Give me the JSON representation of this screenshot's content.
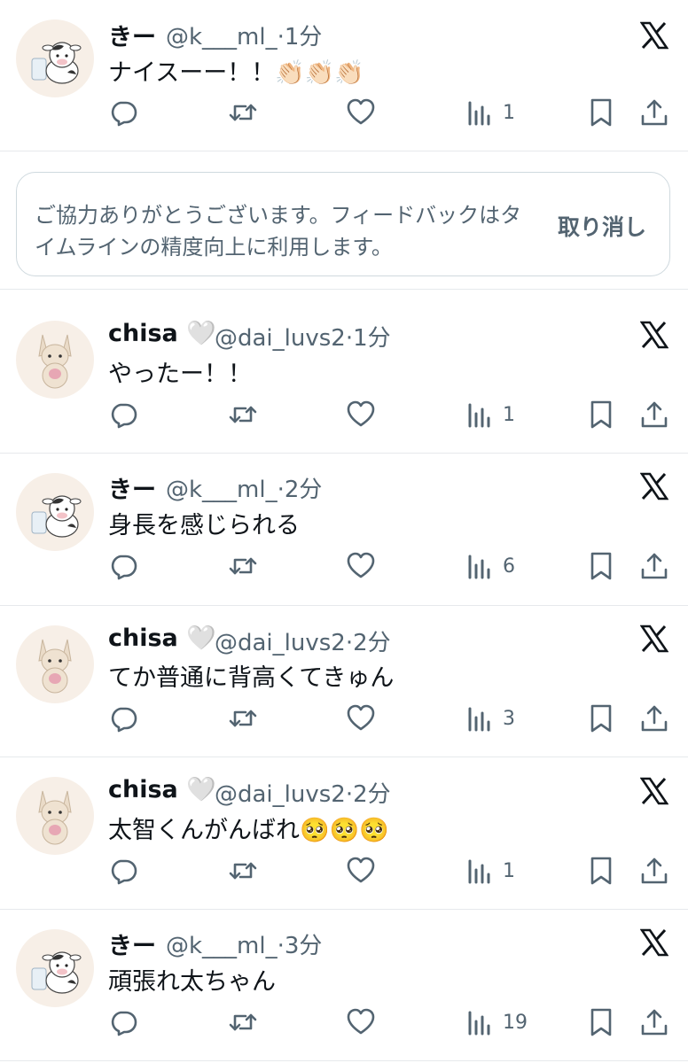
{
  "feedback": {
    "message": "ご協力ありがとうございます。フィードバックはタイムラインの精度向上に利用します。",
    "undo_label": "取り消し"
  },
  "tweets": [
    {
      "name": "きー",
      "handle": "@k___ml_·1分",
      "text": "ナイスーー！！👏🏻👏🏻👏🏻",
      "views": "1",
      "avatar": "cow"
    },
    {
      "name": "chisa 🤍",
      "handle": "@dai_luvs2·1分",
      "text": "やったー！！",
      "views": "1",
      "avatar": "dog"
    },
    {
      "name": "きー",
      "handle": "@k___ml_·2分",
      "text": "身長を感じられる",
      "views": "6",
      "avatar": "cow"
    },
    {
      "name": "chisa 🤍",
      "handle": "@dai_luvs2·2分",
      "text": "てか普通に背高くてきゅん",
      "views": "3",
      "avatar": "dog"
    },
    {
      "name": "chisa 🤍",
      "handle": "@dai_luvs2·2分",
      "text": "太智くんがんばれ🥺🥺🥺",
      "views": "1",
      "avatar": "dog"
    },
    {
      "name": "きー",
      "handle": "@k___ml_·3分",
      "text": "頑張れ太ちゃん",
      "views": "19",
      "avatar": "cow"
    }
  ],
  "icons": {
    "reply": "reply-icon",
    "retweet": "retweet-icon",
    "like": "like-icon",
    "views": "views-icon",
    "bookmark": "bookmark-icon",
    "share": "share-icon",
    "platform": "x-logo-icon"
  },
  "colors": {
    "text": "#0f1419",
    "secondary": "#536471",
    "divider": "#e6e9ec",
    "avatar_bg": "#f7efe7"
  }
}
